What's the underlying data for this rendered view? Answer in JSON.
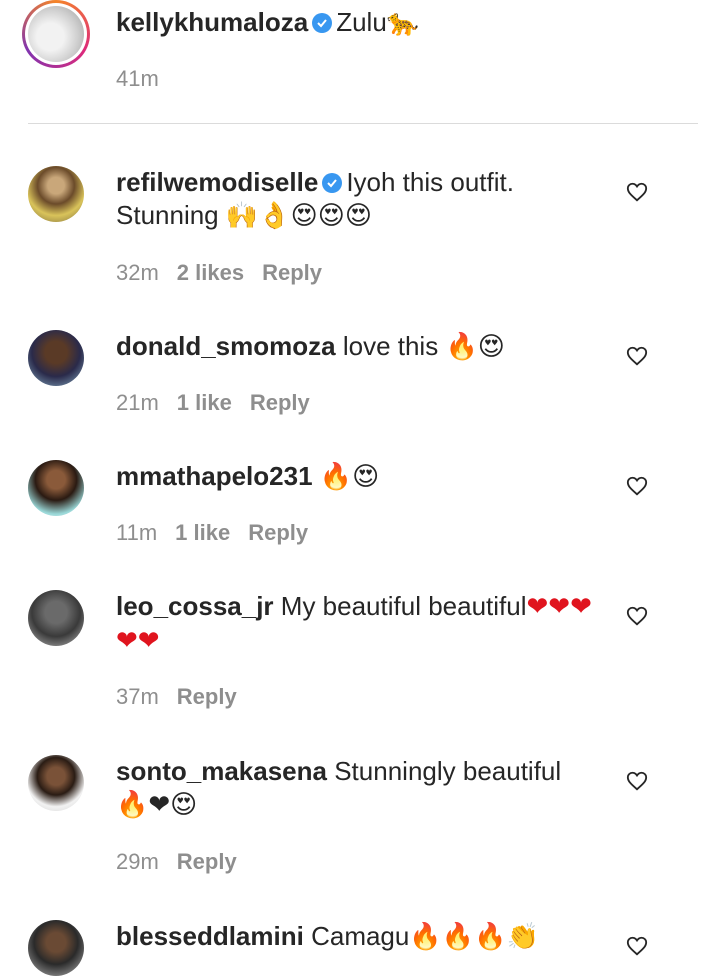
{
  "caption": {
    "username": "kellykhumaloza",
    "text": "Zulu",
    "emoji": "🐆",
    "time": "41m"
  },
  "comments": [
    {
      "username": "refilwemodiselle",
      "verified": true,
      "text": "Iyoh this outfit. Stunning ",
      "emoji": "🙌👌😍😍😍",
      "time": "32m",
      "likes": "2 likes",
      "reply": "Reply"
    },
    {
      "username": "donald_smomoza",
      "text": "love this ",
      "emoji": "🔥😍",
      "time": "21m",
      "likes": "1 like",
      "reply": "Reply"
    },
    {
      "username": "mmathapelo231",
      "text": " ",
      "emoji": "🔥😍",
      "time": "11m",
      "likes": "1 like",
      "reply": "Reply"
    },
    {
      "username": "leo_cossa_jr",
      "text": "My beautiful beautiful",
      "emoji": "❤❤❤❤❤",
      "time": "37m",
      "reply": "Reply"
    },
    {
      "username": "sonto_makasena",
      "text": "Stunningly beautiful ",
      "emoji": "🔥❤😍",
      "time": "29m",
      "reply": "Reply"
    },
    {
      "username": "blesseddlamini",
      "text": "Camagu",
      "emoji": "🔥🔥🔥👏"
    }
  ],
  "colors": {
    "verified": "#3897f0",
    "meta_text": "#8e8e8e",
    "divider": "#dbdbdb"
  },
  "icons": {
    "verified": "verified-badge-icon",
    "like": "heart-outline-icon"
  }
}
